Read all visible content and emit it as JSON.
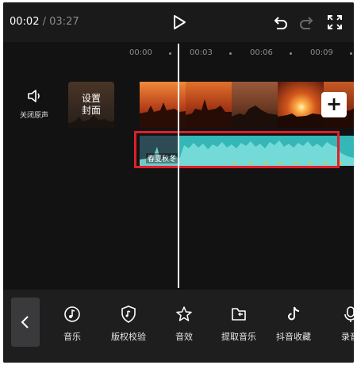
{
  "player": {
    "current_time": "00:02",
    "separator": "/",
    "duration": "03:27"
  },
  "timeline": {
    "ticks": [
      "00:00",
      "00:03",
      "00:06",
      "00:09"
    ],
    "mute_label": "关闭原声",
    "cover_label_line1": "设置",
    "cover_label_line2": "封面",
    "add_clip": "+",
    "audio_clip_label": "春夏秋冬",
    "highlight_color": "#e01e2a",
    "audio_color": "#35b6b7"
  },
  "toolbar": {
    "items": [
      {
        "label": "音乐",
        "icon": "music-icon"
      },
      {
        "label": "版权校验",
        "icon": "copyright-check-icon"
      },
      {
        "label": "音效",
        "icon": "sound-effect-icon"
      },
      {
        "label": "提取音乐",
        "icon": "extract-music-icon"
      },
      {
        "label": "抖音收藏",
        "icon": "douyin-favorites-icon"
      },
      {
        "label": "录音",
        "icon": "record-icon"
      }
    ]
  }
}
